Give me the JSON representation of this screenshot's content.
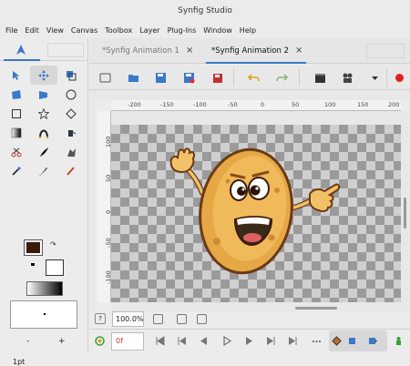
{
  "window": {
    "title": "Synfig Studio"
  },
  "menu": [
    "File",
    "Edit",
    "View",
    "Canvas",
    "Toolbox",
    "Layer",
    "Plug-Ins",
    "Window",
    "Help"
  ],
  "documents": {
    "tabs": [
      {
        "label": "*Synfig Animation 1",
        "active": false
      },
      {
        "label": "*Synfig Animation 2",
        "active": true
      }
    ],
    "close_glyph": "⨯"
  },
  "ruler": {
    "h_ticks": [
      "-200",
      "-150",
      "-100",
      "-50",
      "0",
      "50",
      "100",
      "150",
      "200"
    ],
    "v_ticks": [
      "100",
      "50",
      "0",
      "-50",
      "-100"
    ]
  },
  "brush": {
    "size_label": "1pt",
    "minus": "-",
    "plus": "+"
  },
  "zoom": {
    "value": "100.0%",
    "help": "?"
  },
  "time": {
    "current": "0f"
  },
  "colors": {
    "accent": "#3a78c9",
    "outline": "#3a1a0a",
    "fill": "#ffffff",
    "record": "#e02020"
  }
}
